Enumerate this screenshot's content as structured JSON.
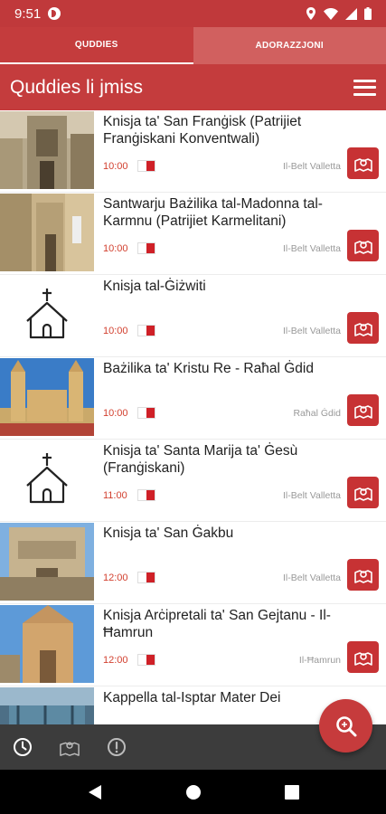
{
  "status_bar": {
    "time": "9:51"
  },
  "tabs": [
    {
      "label": "QUDDIES"
    },
    {
      "label": "ADORAZZJONI"
    }
  ],
  "app_bar": {
    "title": "Quddies li jmiss"
  },
  "colors": {
    "primary": "#c43c3d",
    "time_red": "#d2402f",
    "map_button": "#c73234"
  },
  "items": [
    {
      "title": "Knisja ta' San Franġisk (Patrijiet Franġiskani Konventwali)",
      "time": "10:00",
      "location": "Il-Belt Valletta",
      "image": "photo"
    },
    {
      "title": "Santwarju Bażilika tal-Madonna tal-Karmnu (Patrijiet Karmelitani)",
      "time": "10:00",
      "location": "Il-Belt Valletta",
      "image": "photo"
    },
    {
      "title": "Knisja tal-Ġiżwiti",
      "time": "10:00",
      "location": "Il-Belt Valletta",
      "image": "church-icon"
    },
    {
      "title": "Bażilika ta' Kristu Re - Raħal Ġdid",
      "time": "10:00",
      "location": "Raħal Ġdid",
      "image": "photo"
    },
    {
      "title": "Knisja ta' Santa Marija ta' Ġesù (Franġiskani)",
      "time": "11:00",
      "location": "Il-Belt Valletta",
      "image": "church-icon"
    },
    {
      "title": "Knisja ta' San Ġakbu",
      "time": "12:00",
      "location": "Il-Belt Valletta",
      "image": "photo"
    },
    {
      "title": "Knisja Arċipretali ta' San Gejtanu - Il-Ħamrun",
      "time": "12:00",
      "location": "Il-Ħamrun",
      "image": "photo"
    },
    {
      "title": "Kappella tal-Isptar Mater Dei",
      "time": "",
      "location": "",
      "image": "photo"
    }
  ]
}
